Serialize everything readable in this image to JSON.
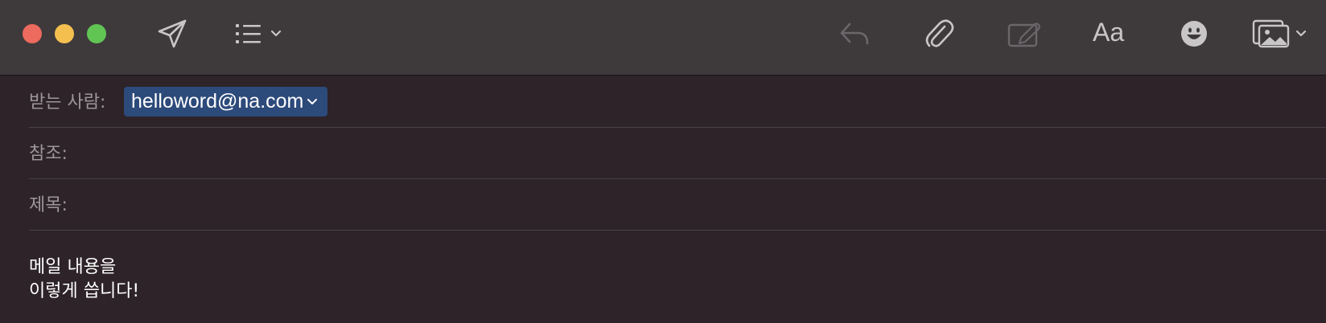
{
  "window": {
    "controls": [
      "close",
      "minimize",
      "zoom"
    ],
    "colors": {
      "close": "#ed6a5e",
      "minimize": "#f5bf4f",
      "zoom": "#61c554"
    }
  },
  "toolbar": {
    "send_icon": "paper-plane-icon",
    "format_list_icon": "list-icon",
    "reply_icon": "reply-arrow-icon",
    "attach_icon": "paperclip-icon",
    "markup_icon": "markup-icon",
    "font_label": "Aa",
    "emoji_icon": "emoji-icon",
    "photo_icon": "photo-browser-icon"
  },
  "compose": {
    "to_label": "받는 사람:",
    "to_recipient": "helloword@na.com",
    "cc_label": "참조:",
    "subject_label": "제목:",
    "body_lines": [
      "메일 내용을",
      "이렇게 씁니다!"
    ]
  },
  "colors": {
    "toolbar_bg": "#3e3a3c",
    "content_bg": "#2d2328",
    "token_bg": "#2c4a7a"
  }
}
